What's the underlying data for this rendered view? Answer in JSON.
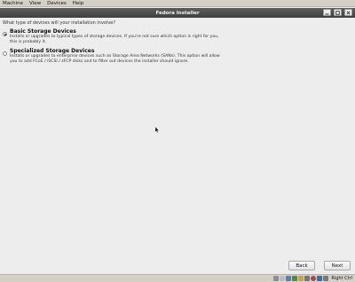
{
  "menubar": {
    "items": [
      "Machine",
      "View",
      "Devices",
      "Help"
    ]
  },
  "window": {
    "title": "Fedora Installer"
  },
  "content": {
    "question": "What type of devices will your installation involve?",
    "options": [
      {
        "title": "Basic Storage Devices",
        "desc_line1": "Installs or upgrades to typical types of storage devices.  If you're not sure which option is right for you,",
        "desc_line2": "this is probably it.",
        "selected": true
      },
      {
        "title": "Specialized Storage Devices",
        "desc_line1": "Installs or upgrades to enterprise devices such as Storage Area Networks (SANs). This option will allow",
        "desc_line2": "you to add FCoE / iSCSI / zFCP disks and to filter out devices the installer should ignore.",
        "selected": false
      }
    ]
  },
  "buttons": {
    "back": "Back",
    "next": "Next"
  },
  "statusbar": {
    "icons": [
      "hard-disk-icon",
      "optical-drive-icon",
      "usb-icon",
      "network-icon",
      "shared-folder-icon",
      "display-icon",
      "video-capture-icon",
      "cpu-icon",
      "mouse-integration-icon"
    ],
    "host_key": "Right Ctrl"
  }
}
